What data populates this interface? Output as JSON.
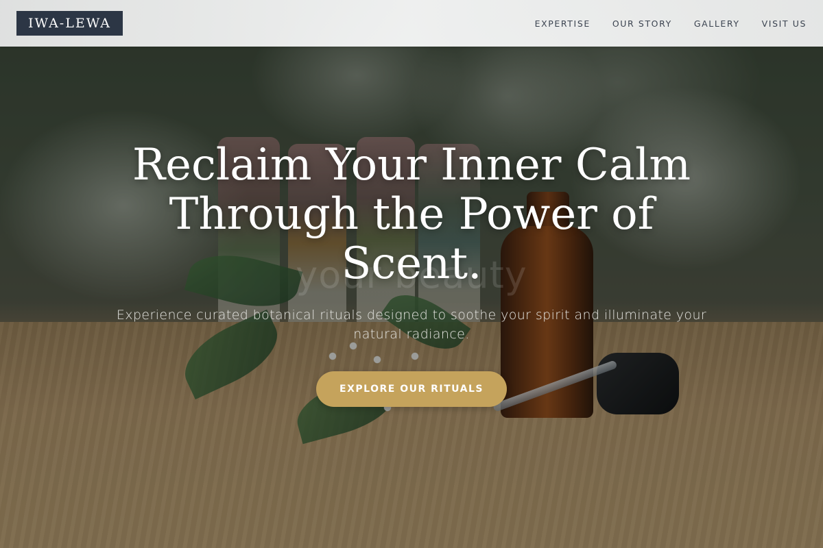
{
  "header": {
    "logo_text": "IWA-LEWA",
    "nav": [
      {
        "label": "EXPERTISE"
      },
      {
        "label": "OUR STORY"
      },
      {
        "label": "GALLERY"
      },
      {
        "label": "VISIT US"
      }
    ]
  },
  "hero": {
    "headline": "Reclaim Your Inner Calm Through the Power of Scent.",
    "ghost_text": "your beauty",
    "subtitle": "Experience curated botanical rituals designed to soothe your spirit and illuminate your natural radiance.",
    "cta_label": "EXPLORE OUR RITUALS",
    "background_image": "essential-oil-bottles-with-white-flowers-on-wooden-table"
  },
  "colors": {
    "logo_bg": "#2c3645",
    "cta_bg": "#c5a35c",
    "nav_text": "#3b4350",
    "header_bg": "#f3f4f4"
  }
}
